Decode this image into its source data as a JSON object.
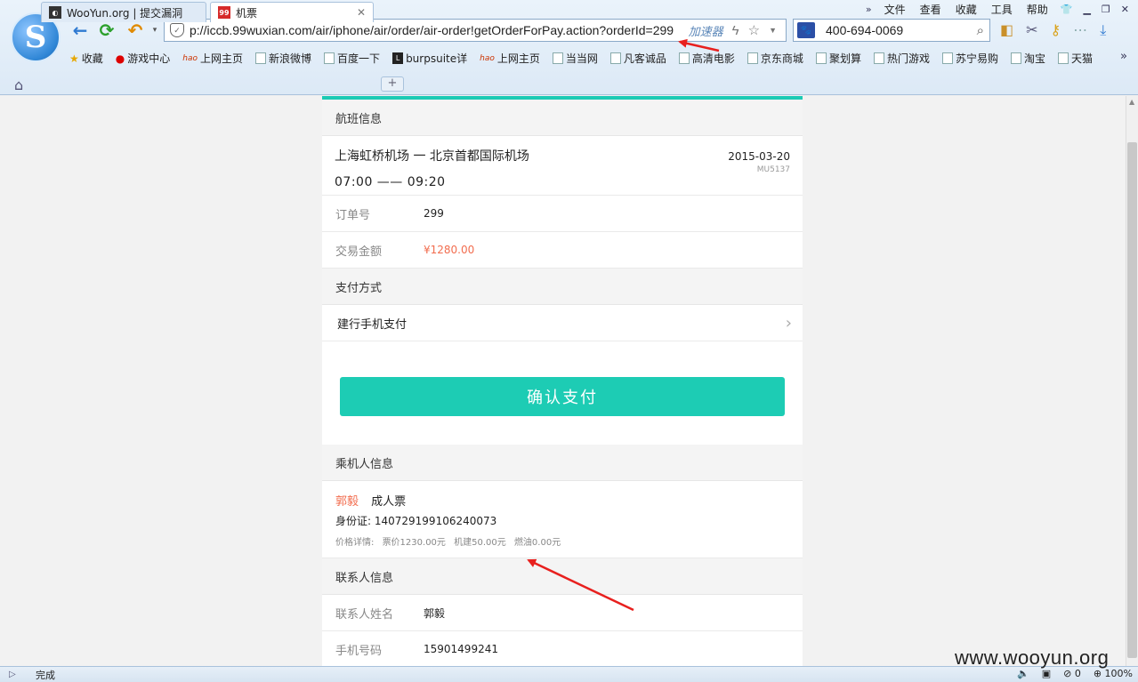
{
  "browser": {
    "menu": [
      "文件",
      "查看",
      "收藏",
      "工具",
      "帮助"
    ],
    "url": "p://iccb.99wuxian.com/air/iphone/air/order/air-order!getOrderForPay.action?orderId=299",
    "accelerator_label": "加速器",
    "search_value": "400-694-0069",
    "bookmarks": [
      "收藏",
      "游戏中心",
      "上网主页",
      "新浪微博",
      "百度一下",
      "burpsuite详",
      "上网主页",
      "当当网",
      "凡客诚品",
      "高清电影",
      "京东商城",
      "聚划算",
      "热门游戏",
      "苏宁易购",
      "淘宝",
      "天猫"
    ],
    "tabs": [
      {
        "label": "WooYun.org | 提交漏洞",
        "active": false
      },
      {
        "label": "机票",
        "favicon_text": "99",
        "active": true
      }
    ],
    "status_text": "完成",
    "status_right": {
      "count": "0",
      "zoom": "100%"
    },
    "watermark": "www.wooyun.org"
  },
  "page": {
    "flight_section_title": "航班信息",
    "flight": {
      "route": "上海虹桥机场  一  北京首都国际机场",
      "times": "07:00  ——  09:20",
      "date": "2015-03-20",
      "flight_no": "MU5137"
    },
    "order": {
      "order_no_label": "订单号",
      "order_no": "299",
      "amount_label": "交易金额",
      "amount": "¥1280.00"
    },
    "payment_section_title": "支付方式",
    "payment_method": "建行手机支付",
    "confirm_button": "确认支付",
    "passenger_section_title": "乘机人信息",
    "passenger": {
      "name": "郭毅",
      "ticket_type": "成人票",
      "id_line": "身份证: 140729199106240073",
      "price_label": "价格详情:",
      "ticket_price": "票价1230.00元",
      "airport_fee": "机建50.00元",
      "fuel_fee": "燃油0.00元"
    },
    "contact_section_title": "联系人信息",
    "contact": {
      "name_label": "联系人姓名",
      "name": "郭毅",
      "phone_label": "手机号码",
      "phone": "15901499241"
    }
  },
  "colors": {
    "accent": "#1dccb4",
    "price_red": "#f26d4f",
    "annotation": "#e8201e"
  }
}
